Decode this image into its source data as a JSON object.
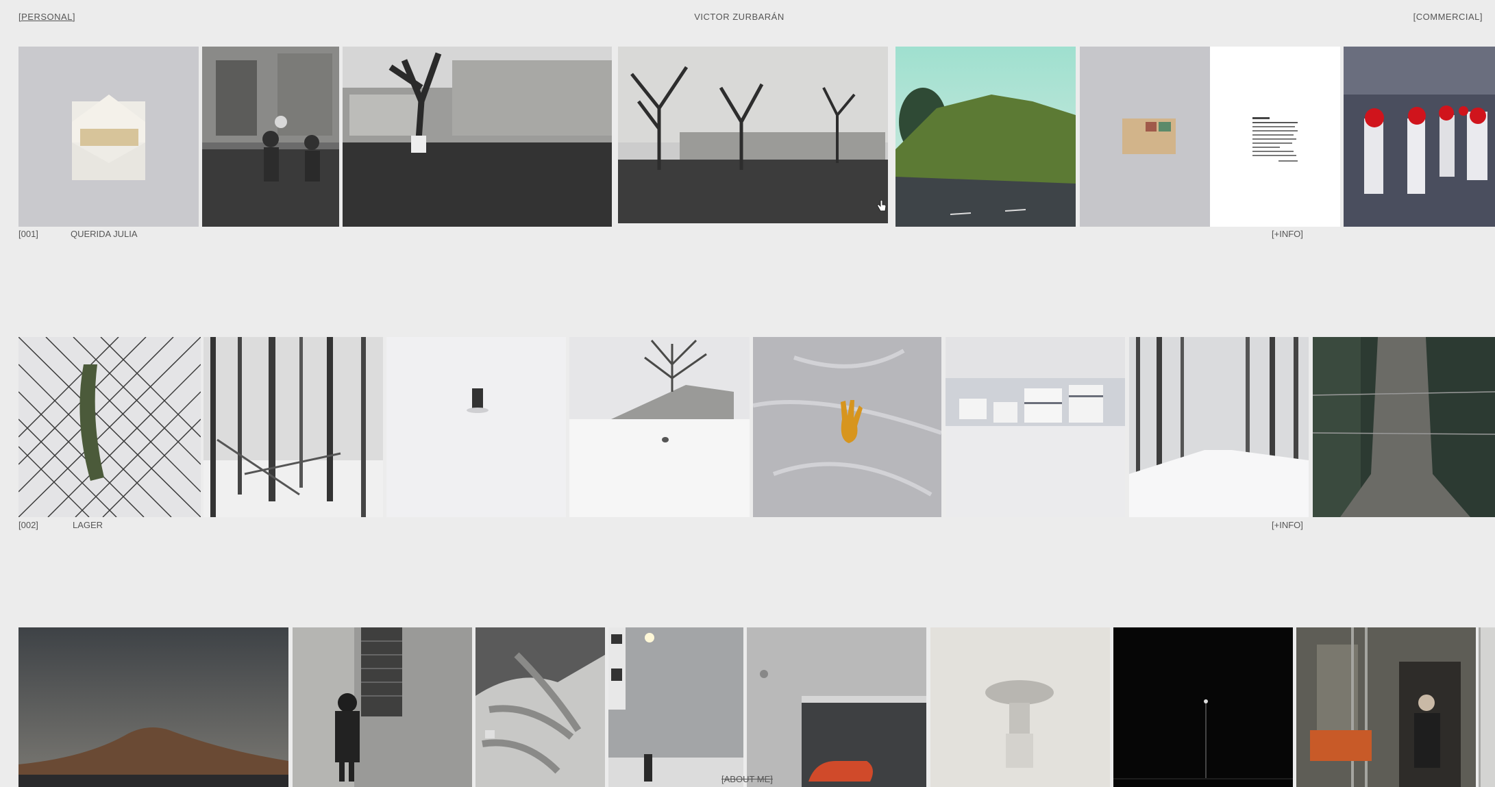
{
  "header": {
    "left_link": "[PERSONAL]",
    "title": "VICTOR ZURBARÁN",
    "right_link": "[COMMERCIAL]"
  },
  "projects": [
    {
      "id": "[001]",
      "title": "QUERIDA JULIA",
      "info": "[+INFO]"
    },
    {
      "id": "[002]",
      "title": "LAGER",
      "info": "[+INFO]"
    }
  ],
  "footer": {
    "about": "[ABOUT ME]"
  },
  "cursor": "hand-pointer-icon"
}
